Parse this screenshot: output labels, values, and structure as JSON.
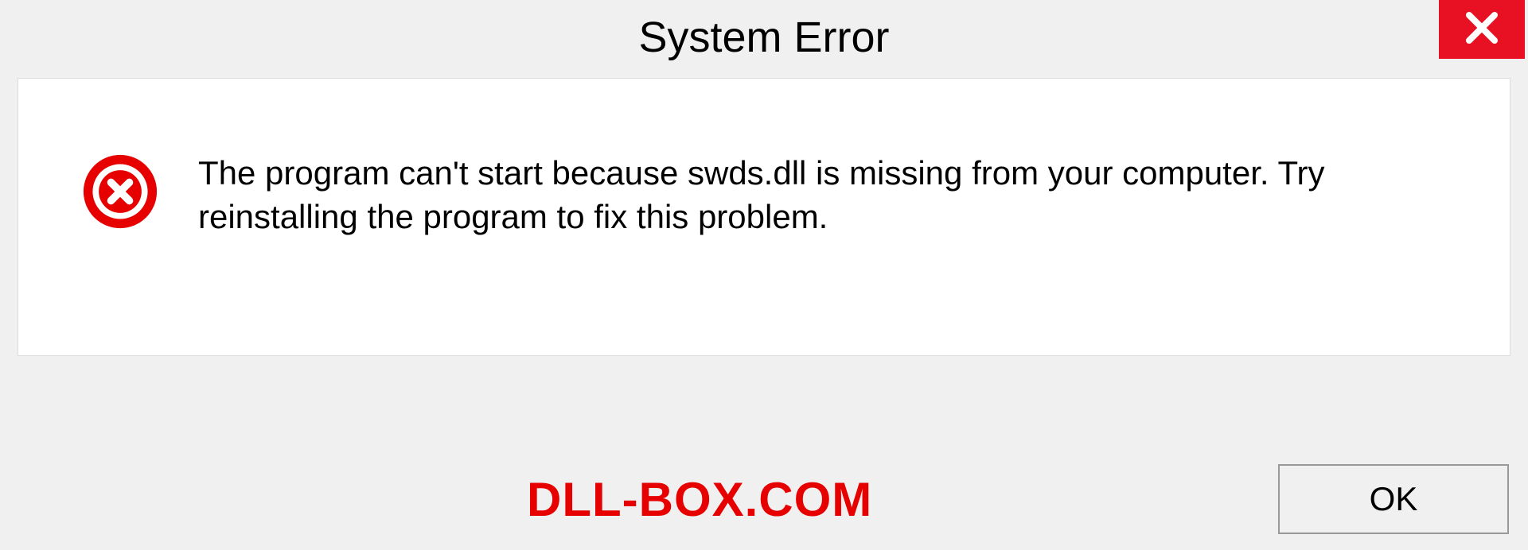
{
  "titlebar": {
    "title": "System Error"
  },
  "dialog": {
    "message": "The program can't start because swds.dll is missing from your computer. Try reinstalling the program to fix this problem."
  },
  "footer": {
    "watermark": "DLL-BOX.COM",
    "ok_label": "OK"
  },
  "colors": {
    "close_bg": "#e81123",
    "error_icon": "#e60000",
    "watermark": "#e60000"
  }
}
